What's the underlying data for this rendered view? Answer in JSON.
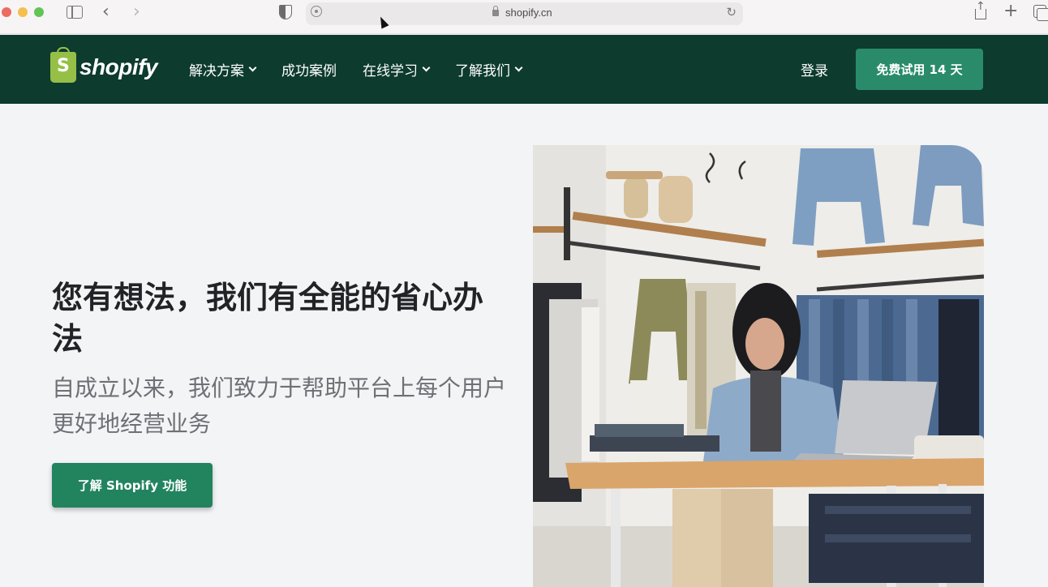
{
  "browser": {
    "url": "shopify.cn"
  },
  "header": {
    "logo_text": "shopify",
    "nav": [
      {
        "label": "解决方案",
        "has_dropdown": true
      },
      {
        "label": "成功案例",
        "has_dropdown": false
      },
      {
        "label": "在线学习",
        "has_dropdown": true
      },
      {
        "label": "了解我们",
        "has_dropdown": true
      }
    ],
    "login_label": "登录",
    "trial_label": "免费试用 14 天"
  },
  "hero": {
    "title": "您有想法，我们有全能的省心办法",
    "subtitle": "自成立以来，我们致力于帮助平台上每个用户更好地经营业务",
    "cta_label": "了解 Shopify 功能"
  },
  "colors": {
    "header_bg": "#0d3b2e",
    "accent_green": "#2a8b6b",
    "logo_green": "#95bf47",
    "page_bg": "#f3f4f6"
  }
}
